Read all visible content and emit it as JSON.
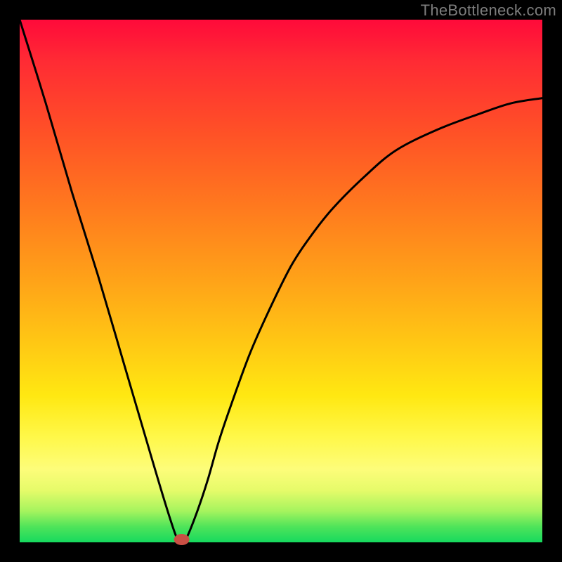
{
  "watermark": "TheBottleneck.com",
  "chart_data": {
    "type": "line",
    "title": "",
    "xlabel": "",
    "ylabel": "",
    "xlim": [
      0,
      1
    ],
    "ylim": [
      0,
      1
    ],
    "series": [
      {
        "name": "bottleneck-curve",
        "x": [
          0.0,
          0.05,
          0.1,
          0.15,
          0.2,
          0.25,
          0.28,
          0.3,
          0.31,
          0.32,
          0.34,
          0.36,
          0.38,
          0.4,
          0.44,
          0.48,
          0.52,
          0.56,
          0.6,
          0.66,
          0.72,
          0.8,
          0.88,
          0.94,
          1.0
        ],
        "y": [
          1.0,
          0.84,
          0.67,
          0.51,
          0.34,
          0.17,
          0.07,
          0.01,
          0.0,
          0.01,
          0.06,
          0.12,
          0.19,
          0.25,
          0.36,
          0.45,
          0.53,
          0.59,
          0.64,
          0.7,
          0.75,
          0.79,
          0.82,
          0.84,
          0.85
        ]
      }
    ],
    "marker": {
      "x": 0.31,
      "y": 0.0,
      "color": "#c94f44"
    }
  },
  "colors": {
    "curve": "#000000",
    "marker": "#c94f44",
    "background_top": "#ff0a3a",
    "background_bottom": "#16d95e",
    "frame": "#000000"
  }
}
